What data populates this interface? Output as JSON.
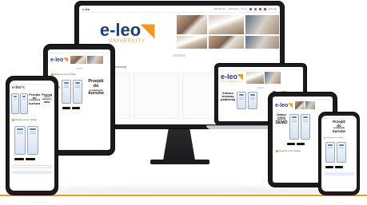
{
  "brand": {
    "logo_text": "e-leo",
    "logo_sub": "UNIVERSITY",
    "accent_color": "#f39a1e",
    "logo_color": "#1d3d7a"
  },
  "monitor": {
    "nav_items": [
      "Aktualności",
      "Szkolenia",
      "Kursy"
    ],
    "login_label": "Zaloguj"
  },
  "promo": {
    "headline_line1": "Przejdź",
    "headline_line2": "do",
    "headline_line3": "zestawienia",
    "headline_line4": "kursów",
    "headline_alt_line1": "Poznaj",
    "headline_alt_line2": "naszą",
    "headline_alt_line3": "skarbnicę",
    "headline_alt_line4": "wiki",
    "demo_line1": "Zobacz",
    "demo_line2": "testową",
    "demo_line3": "platformę",
    "demo_line4": "DEMO",
    "badge": "NA",
    "section_title": "Dostępne przez Infolinię"
  }
}
